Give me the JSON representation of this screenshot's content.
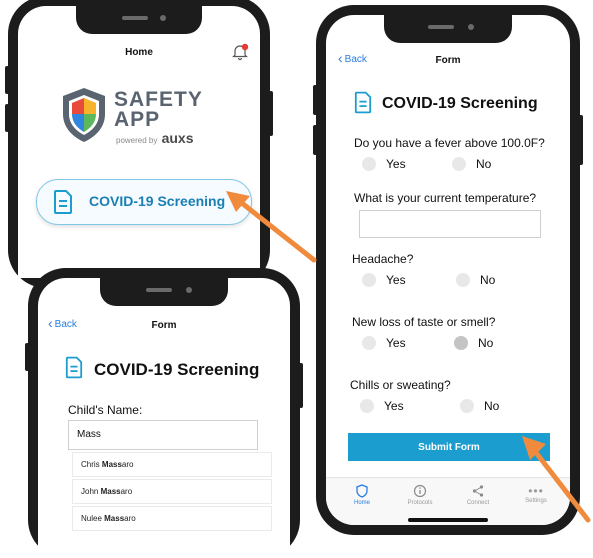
{
  "home_phone": {
    "nav_title": "Home",
    "logo": {
      "line1": "SAFETY",
      "line2": "APP",
      "powered_by": "powered by",
      "brand": "auxs"
    },
    "screening_button_label": "COVID-19 Screening"
  },
  "child_phone": {
    "back_label": "Back",
    "nav_title": "Form",
    "heading": "COVID-19 Screening",
    "name_label": "Child's Name:",
    "name_value": "Mass",
    "suggestions": [
      {
        "first": "Chris",
        "match": "Mass",
        "rest": "aro"
      },
      {
        "first": "John",
        "match": "Mass",
        "rest": "aro"
      },
      {
        "first": "Nulee",
        "match": "Mass",
        "rest": "aro"
      }
    ]
  },
  "form_phone": {
    "back_label": "Back",
    "nav_title": "Form",
    "heading": "COVID-19 Screening",
    "questions": [
      {
        "text": "Do you have a fever above 100.0F?",
        "yes": "Yes",
        "no": "No"
      },
      {
        "text": "What is your current temperature?"
      },
      {
        "text": "Headache?",
        "yes": "Yes",
        "no": "No"
      },
      {
        "text": "New loss of taste or smell?",
        "yes": "Yes",
        "no": "No"
      },
      {
        "text": "Chills or sweating?",
        "yes": "Yes",
        "no": "No"
      }
    ],
    "submit_label": "Submit Form",
    "tabs": [
      {
        "label": "Home",
        "icon": "shield-icon",
        "active": true
      },
      {
        "label": "Protocols",
        "icon": "info-icon",
        "active": false
      },
      {
        "label": "Connect",
        "icon": "share-icon",
        "active": false
      },
      {
        "label": "Settings",
        "icon": "more-icon",
        "active": false
      }
    ]
  },
  "colors": {
    "accent": "#1b9dd0",
    "link": "#2a7de1",
    "arrow": "#f08a3c",
    "badge": "#e53935"
  }
}
